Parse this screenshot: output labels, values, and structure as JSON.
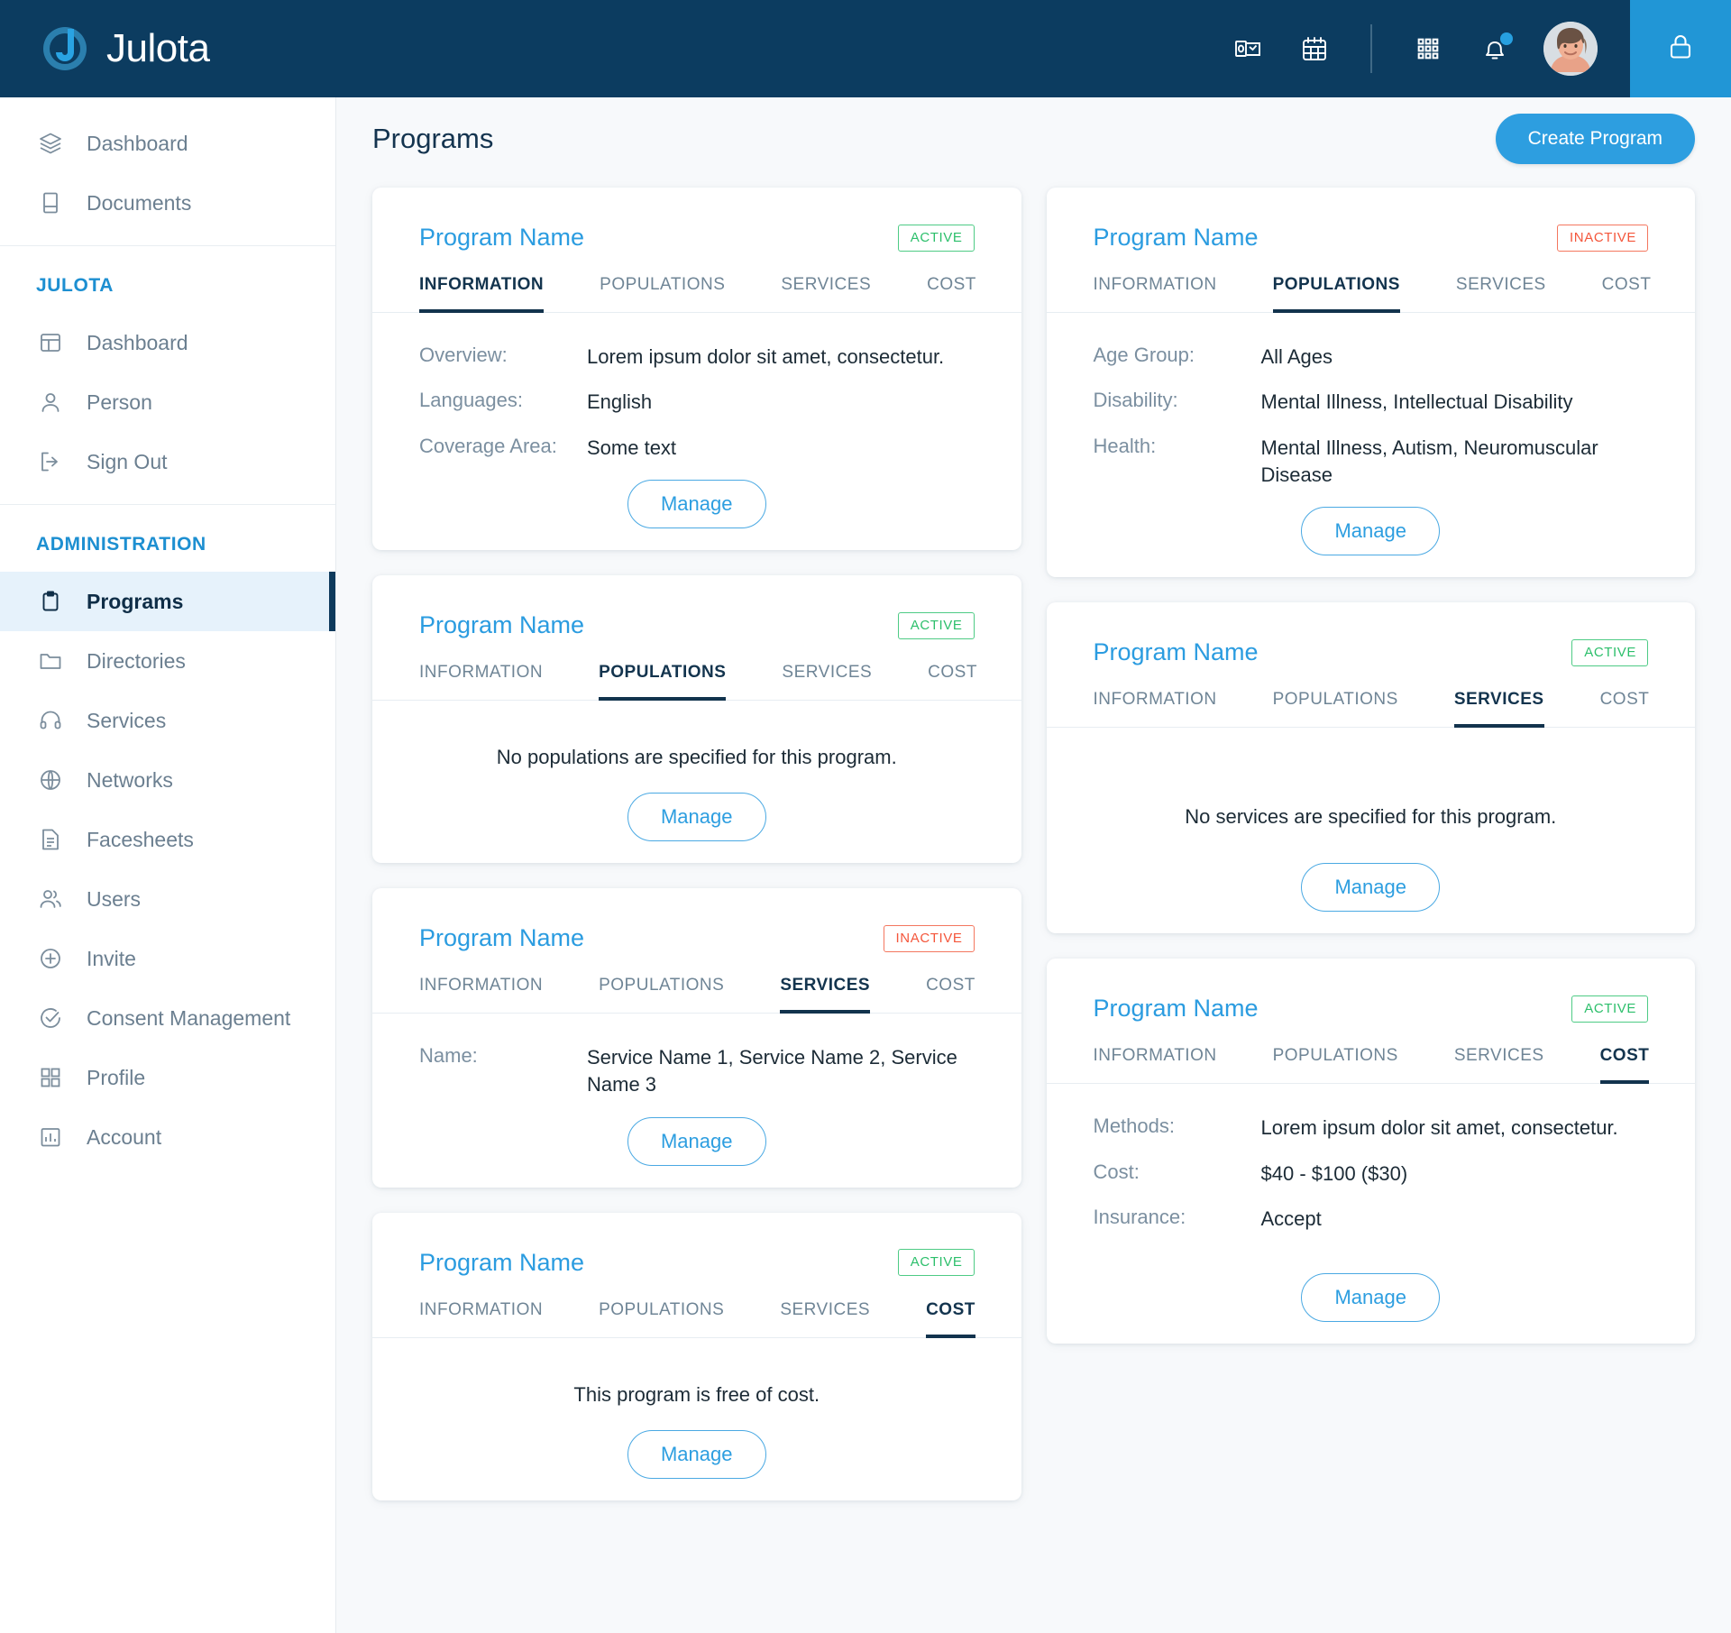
{
  "app": {
    "brand_name": "Julota",
    "logo_icon": "julota-circle-j-logo"
  },
  "topbar": {
    "icons": [
      {
        "name": "outlook-icon",
        "label": "Outlook"
      },
      {
        "name": "calendar-icon",
        "label": "Calendar"
      },
      {
        "name": "apps-grid-icon",
        "label": "Apps"
      },
      {
        "name": "notifications-bell-icon",
        "label": "Notifications"
      }
    ],
    "avatar_label": "User avatar",
    "lock_label": "Lock",
    "notification_dot": true,
    "accent_color": "#2196d6",
    "bar_color": "#0c3c60"
  },
  "sidebar": {
    "groups": [
      {
        "label": "",
        "items": [
          {
            "label": "Dashboard",
            "icon": "layers-icon",
            "active": false
          },
          {
            "label": "Documents",
            "icon": "book-icon",
            "active": false
          }
        ]
      },
      {
        "label": "JULOTA",
        "items": [
          {
            "label": "Dashboard",
            "icon": "layout-icon",
            "active": false
          },
          {
            "label": "Person",
            "icon": "person-icon",
            "active": false
          },
          {
            "label": "Sign Out",
            "icon": "sign-out-icon",
            "active": false
          }
        ]
      },
      {
        "label": "ADMINISTRATION",
        "items": [
          {
            "label": "Programs",
            "icon": "clipboard-icon",
            "active": true
          },
          {
            "label": "Directories",
            "icon": "folder-icon",
            "active": false
          },
          {
            "label": "Services",
            "icon": "headset-icon",
            "active": false
          },
          {
            "label": "Networks",
            "icon": "globe-icon",
            "active": false
          },
          {
            "label": "Facesheets",
            "icon": "document-lines-icon",
            "active": false
          },
          {
            "label": "Users",
            "icon": "users-icon",
            "active": false
          },
          {
            "label": "Invite",
            "icon": "plus-circle-icon",
            "active": false
          },
          {
            "label": "Consent Management",
            "icon": "check-circle-icon",
            "active": false
          },
          {
            "label": "Profile",
            "icon": "grid-squares-icon",
            "active": false
          },
          {
            "label": "Account",
            "icon": "bar-chart-icon",
            "active": false
          }
        ]
      }
    ]
  },
  "main": {
    "page_title": "Programs",
    "create_button": "Create Program",
    "manage_button": "Manage",
    "tab_labels": [
      "INFORMATION",
      "POPULATIONS",
      "SERVICES",
      "COST"
    ],
    "status": {
      "active": "ACTIVE",
      "inactive": "INACTIVE"
    },
    "columns": [
      {
        "cards": [
          {
            "title": "Program Name",
            "status": "ACTIVE",
            "status_kind": "active",
            "active_tab": 0,
            "rows": [
              {
                "key": "Overview:",
                "value": "Lorem ipsum dolor sit amet, consectetur."
              },
              {
                "key": "Languages:",
                "value": "English"
              },
              {
                "key": "Coverage Area:",
                "value": "Some text"
              }
            ],
            "message": ""
          },
          {
            "title": "Program Name",
            "status": "ACTIVE",
            "status_kind": "active",
            "active_tab": 1,
            "rows": [],
            "message": "No populations are specified for this program."
          },
          {
            "title": "Program Name",
            "status": "INACTIVE",
            "status_kind": "inactive",
            "active_tab": 2,
            "rows": [
              {
                "key": "Name:",
                "value": "Service Name 1, Service Name 2, Service Name 3"
              }
            ],
            "message": ""
          },
          {
            "title": "Program Name",
            "status": "ACTIVE",
            "status_kind": "active",
            "active_tab": 3,
            "rows": [],
            "message": "This program is free of cost."
          }
        ]
      },
      {
        "cards": [
          {
            "title": "Program Name",
            "status": "INACTIVE",
            "status_kind": "inactive",
            "active_tab": 1,
            "rows": [
              {
                "key": "Age Group:",
                "value": "All Ages"
              },
              {
                "key": "Disability:",
                "value": "Mental Illness, Intellectual Disability"
              },
              {
                "key": "Health:",
                "value": "Mental Illness, Autism, Neuromuscular Disease"
              }
            ],
            "message": ""
          },
          {
            "title": "Program Name",
            "status": "ACTIVE",
            "status_kind": "active",
            "active_tab": 2,
            "rows": [],
            "message": "No services are specified for this program.",
            "message_tall": true
          },
          {
            "title": "Program Name",
            "status": "ACTIVE",
            "status_kind": "active",
            "active_tab": 3,
            "rows": [
              {
                "key": "Methods:",
                "value": "Lorem ipsum dolor sit amet, consectetur."
              },
              {
                "key": "Cost:",
                "value": "$40 - $100 ($30)"
              },
              {
                "key": "Insurance:",
                "value": "Accept"
              }
            ],
            "message": "",
            "manage_gap": true
          }
        ]
      }
    ]
  }
}
